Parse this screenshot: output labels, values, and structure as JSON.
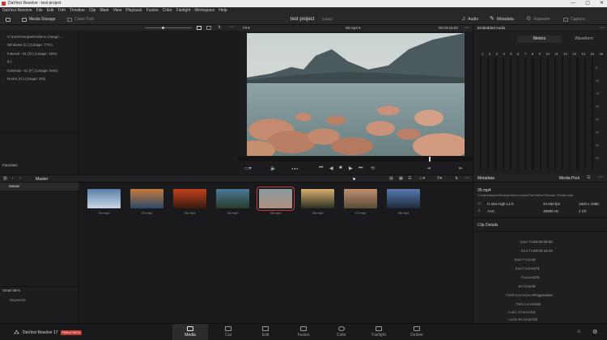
{
  "window": {
    "title": "DaVinci Resolve - test project",
    "controls": [
      "—",
      "▢",
      "✕"
    ]
  },
  "menu": [
    "DaVinci Resolve",
    "File",
    "Edit",
    "Trim",
    "Timeline",
    "Clip",
    "Mark",
    "View",
    "Playback",
    "Fusion",
    "Color",
    "Fairlight",
    "Workspace",
    "Help"
  ],
  "toolbar": {
    "media_storage": "Media Storage",
    "clone_tool": "Clone Tool",
    "project_name": "test project",
    "project_status": "Edited",
    "audio": "Audio",
    "metadata": "Metadata",
    "inspector": "Inspector",
    "capture": "Capture"
  },
  "storage": {
    "items": [
      "C:\\Users\\stopwe\\Videos (Usage:…",
      "Windows (C:) (Usage: 77%)",
      "Internal - 01 (D:) (Usage: 19%)",
      "E:\\",
      "External - 01 (F:) (Usage: 94%)",
      "Drobo (H:) (Usage: 8%)"
    ],
    "favorites": "Favorites"
  },
  "viewer": {
    "fit": "Fit",
    "clip_name": "05.mp4",
    "timecode": "00:03:15:02"
  },
  "audio_panel": {
    "title": "Embedded Audio",
    "tabs": [
      "Meters",
      "Waveform"
    ],
    "channels": [
      "1",
      "2",
      "3",
      "4",
      "5",
      "6",
      "7",
      "8",
      "9",
      "10",
      "11",
      "12",
      "13",
      "14",
      "15",
      "16"
    ],
    "scale": [
      "-5",
      "-10",
      "-15",
      "-20",
      "-25",
      "-30",
      "-40",
      "-50"
    ]
  },
  "media_pool": {
    "bin": "Master",
    "tree_master": "Master",
    "smart_bins": "Smart Bins",
    "keywords": "Keywords",
    "clips": [
      {
        "name": "01.mp4",
        "colors": [
          "#5a7fa8",
          "#c8d8e8"
        ]
      },
      {
        "name": "02.mp4",
        "colors": [
          "#c47a3a",
          "#2a4a6a"
        ]
      },
      {
        "name": "03.mp4",
        "colors": [
          "#c0401a",
          "#3a1a10"
        ]
      },
      {
        "name": "04.mp4",
        "colors": [
          "#4a7a9a",
          "#2a3a2a"
        ]
      },
      {
        "name": "05.mp4",
        "colors": [
          "#8a9aa0",
          "#b09080"
        ]
      },
      {
        "name": "06.mp4",
        "colors": [
          "#d8b070",
          "#2a3020"
        ]
      },
      {
        "name": "07.mp4",
        "colors": [
          "#c09070",
          "#5a4a3a"
        ]
      },
      {
        "name": "08.mp4",
        "colors": [
          "#5a7ab0",
          "#1a2a3a"
        ]
      }
    ],
    "selected_index": 4
  },
  "metadata": {
    "title": "Metadata",
    "pool_label": "Media Pool",
    "file_name": "05.mp4",
    "path": "C:\\Users\\stopwe\\Desktop\\How to Install Free DaVinci Resolve 17\\video clips",
    "codec": "H.264 High L4.0",
    "fps": "24.000 fps",
    "resolution": "1920 x 1080",
    "audio_codec": "AAC",
    "sample_rate": "48000 Hz",
    "channels": "2 Ch",
    "clip_details": "Clip Details",
    "details": [
      {
        "label": "Start TC",
        "value": "00:00:00:00"
      },
      {
        "label": "End TC",
        "value": "00:00:19:19"
      },
      {
        "label": "Start Frame",
        "value": "0"
      },
      {
        "label": "End Frame",
        "value": "474"
      },
      {
        "label": "Frames",
        "value": "475"
      },
      {
        "label": "Bit Depth",
        "value": "8"
      },
      {
        "label": "Field Dominance",
        "value": "Progressive"
      },
      {
        "label": "Data Level",
        "value": "Auto"
      },
      {
        "label": "Audio Channels",
        "value": "2"
      },
      {
        "label": "Audio Bit Depth",
        "value": "32"
      }
    ]
  },
  "bottom": {
    "app_name": "DaVinci Resolve 17",
    "beta": "PUBLIC BETA",
    "pages": [
      "Media",
      "Cut",
      "Edit",
      "Fusion",
      "Color",
      "Fairlight",
      "Deliver"
    ],
    "active_page": 0
  }
}
